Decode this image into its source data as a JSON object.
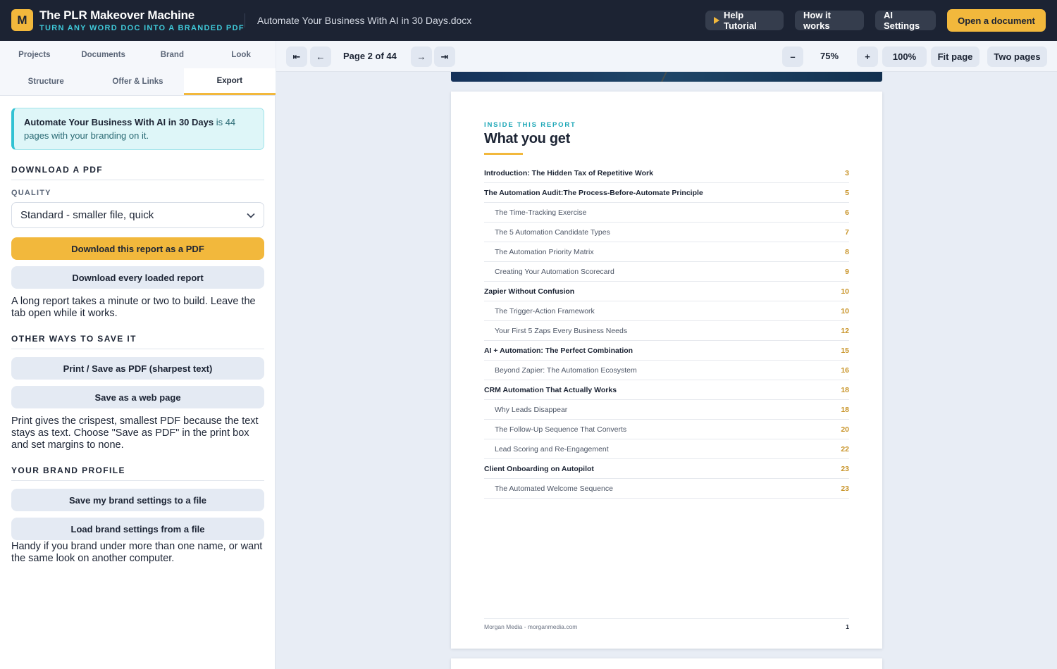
{
  "app": {
    "logo_letter": "M",
    "title": "The PLR Makeover Machine",
    "subtitle": "TURN ANY WORD DOC INTO A BRANDED PDF",
    "document_name": "Automate Your Business With AI in 30 Days.docx",
    "accent": "#f2b83c",
    "teal": "#3fc9d9"
  },
  "topnav": {
    "help_tutorial": "Help Tutorial",
    "how_it_works": "How it works",
    "ai_settings": "AI Settings",
    "open_document": "Open a document"
  },
  "sidebar": {
    "tabs_row1": [
      "Projects",
      "Documents",
      "Brand",
      "Look"
    ],
    "tabs_row2": [
      "Structure",
      "Offer & Links",
      "Export"
    ],
    "active_tab": "Export",
    "notice": {
      "title": "Automate Your Business With AI in 30 Days",
      "text": " is 44 pages with your branding on it."
    },
    "download_pdf": {
      "heading": "DOWNLOAD A PDF",
      "quality_label": "QUALITY",
      "quality_value": "Standard - smaller file, quick",
      "primary_button": "Download this report as a PDF",
      "secondary_button": "Download every loaded report",
      "help": "A long report takes a minute or two to build. Leave the tab open while it works."
    },
    "other_ways": {
      "heading": "OTHER WAYS TO SAVE IT",
      "print_button": "Print / Save as PDF (sharpest text)",
      "web_button": "Save as a web page",
      "help": "Print gives the crispest, smallest PDF because the text stays as text. Choose \"Save as PDF\" in the print box and set margins to none."
    },
    "brand_profile": {
      "heading": "YOUR BRAND PROFILE",
      "save_button": "Save my brand settings to a file",
      "load_button": "Load brand settings from a file",
      "help": "Handy if you brand under more than one name, or want the same look on another computer."
    }
  },
  "viewer": {
    "first": "⇤",
    "prev": "←",
    "page_indicator": "Page 2 of 44",
    "next": "→",
    "last": "⇥",
    "zoom_out": "–",
    "zoom_level": "75%",
    "zoom_in": "+",
    "zoom_100": "100%",
    "fit_page": "Fit page",
    "two_pages": "Two pages"
  },
  "page": {
    "eyebrow": "INSIDE THIS REPORT",
    "heading": "What you get",
    "toc": [
      {
        "title": "Introduction: The Hidden Tax of Repetitive Work",
        "page": "3",
        "level": 1
      },
      {
        "title": "The Automation Audit:The Process-Before-Automate Principle",
        "page": "5",
        "level": 1
      },
      {
        "title": "The Time-Tracking Exercise",
        "page": "6",
        "level": 2
      },
      {
        "title": "The 5 Automation Candidate Types",
        "page": "7",
        "level": 2
      },
      {
        "title": "The Automation Priority Matrix",
        "page": "8",
        "level": 2
      },
      {
        "title": "Creating Your Automation Scorecard",
        "page": "9",
        "level": 2
      },
      {
        "title": "Zapier Without Confusion",
        "page": "10",
        "level": 1
      },
      {
        "title": "The Trigger-Action Framework",
        "page": "10",
        "level": 2
      },
      {
        "title": "Your First 5 Zaps Every Business Needs",
        "page": "12",
        "level": 2
      },
      {
        "title": "AI + Automation: The Perfect Combination",
        "page": "15",
        "level": 1
      },
      {
        "title": "Beyond Zapier: The Automation Ecosystem",
        "page": "16",
        "level": 2
      },
      {
        "title": "CRM Automation That Actually Works",
        "page": "18",
        "level": 1
      },
      {
        "title": "Why Leads Disappear",
        "page": "18",
        "level": 2
      },
      {
        "title": "The Follow-Up Sequence That Converts",
        "page": "20",
        "level": 2
      },
      {
        "title": "Lead Scoring and Re-Engagement",
        "page": "22",
        "level": 2
      },
      {
        "title": "Client Onboarding on Autopilot",
        "page": "23",
        "level": 1
      },
      {
        "title": "The Automated Welcome Sequence",
        "page": "23",
        "level": 2
      }
    ],
    "footer_left": "Morgan Media - morganmedia.com",
    "footer_page": "1"
  }
}
